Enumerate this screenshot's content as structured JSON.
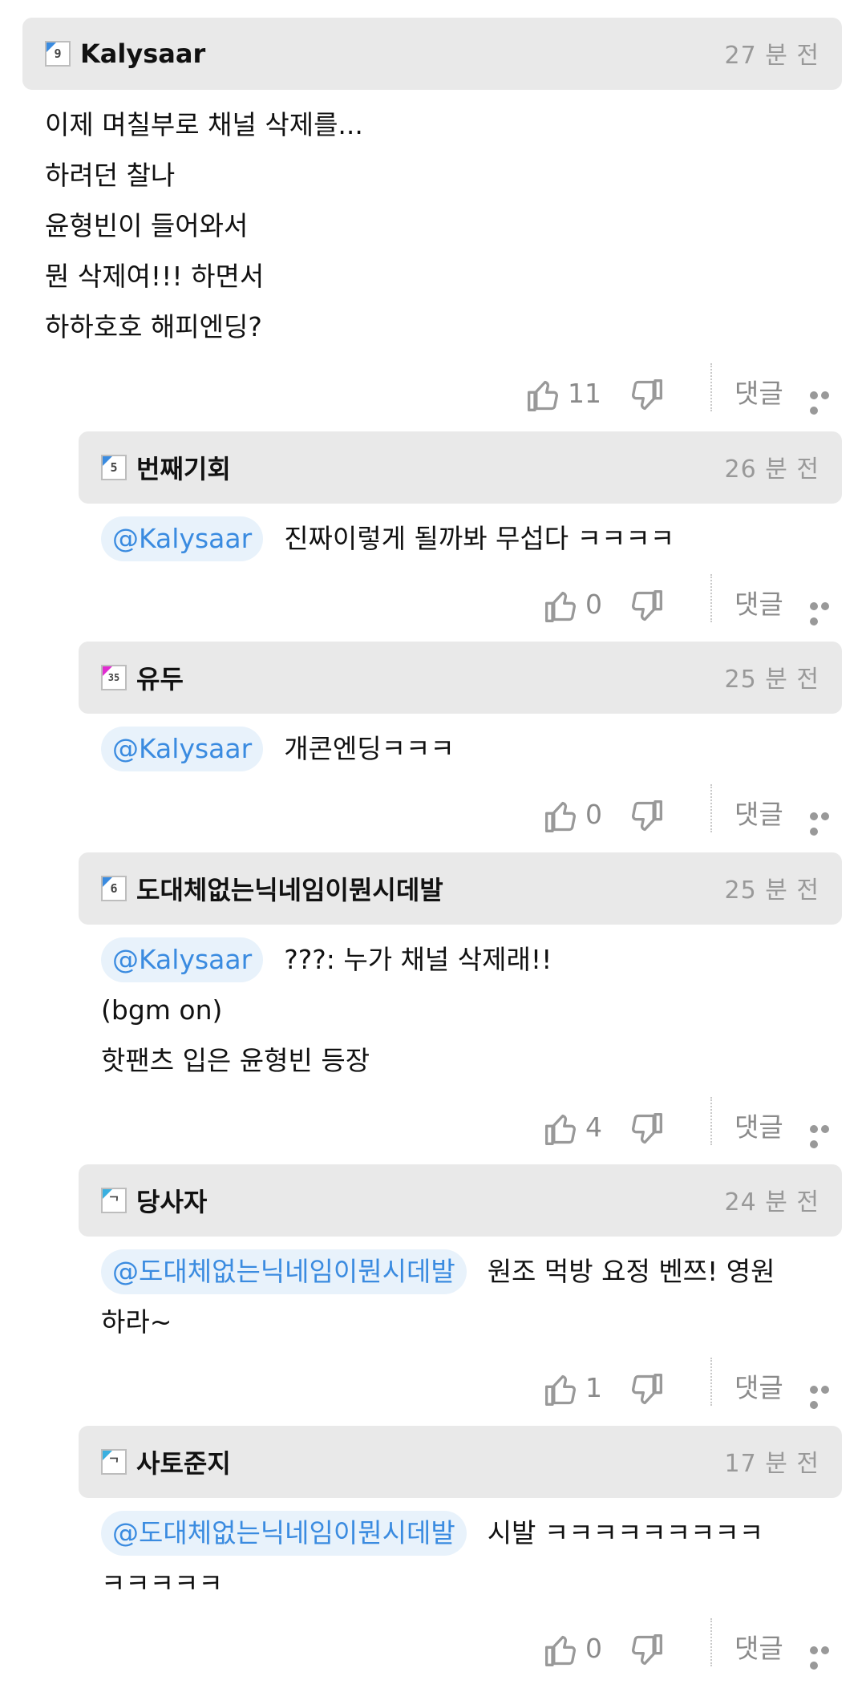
{
  "reply_label": "댓글",
  "comments": [
    {
      "level": "9",
      "flag_color": "#3a8be0",
      "username": "Kalysaar",
      "time": "27 분 전",
      "mention": "",
      "lines": [
        "이제 며칠부로 채널 삭제를...",
        "하려던 찰나",
        "윤형빈이 들어와서",
        "뭔 삭제여!!! 하면서",
        "하하호호 해피엔딩?"
      ],
      "likes": "11"
    },
    {
      "level": "5",
      "flag_color": "#3a8be0",
      "username": "번째기회",
      "time": "26 분 전",
      "mention": "@Kalysaar",
      "lines": [
        "진짜이렇게 될까봐 무섭다 ㅋㅋㅋㅋ"
      ],
      "likes": "0"
    },
    {
      "level": "35",
      "flag_color": "#e02bd0",
      "username": "유두",
      "time": "25 분 전",
      "mention": "@Kalysaar",
      "lines": [
        "개콘엔딩ㅋㅋㅋ"
      ],
      "likes": "0"
    },
    {
      "level": "6",
      "flag_color": "#3a8be0",
      "username": "도대체없는닉네임이뭔시데발",
      "time": "25 분 전",
      "mention": "@Kalysaar",
      "lines": [
        "???: 누가 채널 삭제래!!",
        "(bgm on)",
        "핫팬츠 입은 윤형빈 등장"
      ],
      "likes": "4"
    },
    {
      "level": "ᄀ",
      "flag_color": "#3ab0e0",
      "username": "당사자",
      "time": "24 분 전",
      "mention": "@도대체없는닉네임이뭔시데발",
      "lines": [
        "원조 먹방 요정 벤쯔! 영원",
        "하라~"
      ],
      "likes": "1"
    },
    {
      "level": "ᄀ",
      "flag_color": "#3ab0e0",
      "username": "사토준지",
      "time": "17 분 전",
      "mention": "@도대체없는닉네임이뭔시데발",
      "lines": [
        "시발 ㅋㅋㅋㅋㅋㅋㅋㅋㅋ",
        "ㅋㅋㅋㅋㅋ"
      ],
      "likes": "0"
    }
  ]
}
